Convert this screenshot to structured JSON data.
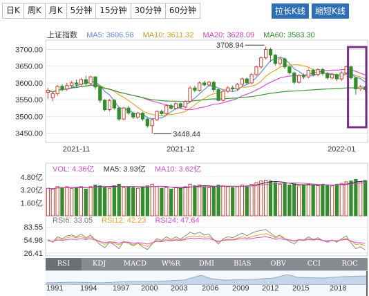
{
  "toolbar": {
    "tabs": [
      {
        "label": "日K",
        "active": true
      },
      {
        "label": "周K",
        "active": false
      },
      {
        "label": "月K",
        "active": false
      },
      {
        "label": "5分钟",
        "active": false
      },
      {
        "label": "15分钟",
        "active": false
      },
      {
        "label": "30分钟",
        "active": false
      },
      {
        "label": "60分钟",
        "active": false
      }
    ],
    "stretch_label": "拉长K线",
    "shrink_label": "缩短K线"
  },
  "main_legend": {
    "name": "上证指数",
    "ma5": "MA5: 3606.58",
    "ma10": "MA10: 3611.32",
    "ma20": "MA20: 3628.09",
    "ma60": "MA60: 3583.30"
  },
  "colors": {
    "up": "#d33b2c",
    "down": "#2f8f2a",
    "ma5": "#5b8fdc",
    "ma10": "#e0a72a",
    "ma20": "#d24bd0",
    "ma60": "#3b9a33",
    "highlight": "#7a2f8d",
    "tab_active": "#2b6cb3"
  },
  "price_axis": {
    "ticks": [
      "3700.00",
      "3650.00",
      "3600.00",
      "3550.00",
      "3500.00",
      "3450.00"
    ],
    "values": [
      3700,
      3650,
      3600,
      3550,
      3500,
      3450
    ],
    "min": 3422,
    "max": 3728
  },
  "date_axis": {
    "labels": [
      "2021-11",
      "2021-12",
      "2022-01"
    ]
  },
  "annotations": {
    "high": "3708.94",
    "low": "3448.44"
  },
  "candles": [
    [
      3572,
      3578,
      3552,
      3585
    ],
    [
      3556,
      3568,
      3545,
      3574
    ],
    [
      3568,
      3590,
      3562,
      3594
    ],
    [
      3590,
      3582,
      3575,
      3596
    ],
    [
      3582,
      3592,
      3576,
      3600
    ],
    [
      3592,
      3600,
      3586,
      3606
    ],
    [
      3600,
      3596,
      3588,
      3610
    ],
    [
      3596,
      3610,
      3590,
      3615
    ],
    [
      3610,
      3598,
      3592,
      3622
    ],
    [
      3598,
      3618,
      3594,
      3622
    ],
    [
      3618,
      3588,
      3580,
      3620
    ],
    [
      3588,
      3548,
      3540,
      3592
    ],
    [
      3548,
      3520,
      3515,
      3552
    ],
    [
      3520,
      3548,
      3515,
      3552
    ],
    [
      3548,
      3525,
      3520,
      3552
    ],
    [
      3525,
      3492,
      3486,
      3528
    ],
    [
      3492,
      3525,
      3488,
      3528
    ],
    [
      3525,
      3510,
      3505,
      3532
    ],
    [
      3510,
      3498,
      3492,
      3514
    ],
    [
      3498,
      3510,
      3492,
      3514
    ],
    [
      3510,
      3492,
      3486,
      3514
    ],
    [
      3492,
      3472,
      3466,
      3496
    ],
    [
      3472,
      3490,
      3448,
      3494
    ],
    [
      3490,
      3515,
      3486,
      3518
    ],
    [
      3515,
      3508,
      3503,
      3520
    ],
    [
      3508,
      3532,
      3504,
      3536
    ],
    [
      3532,
      3524,
      3520,
      3538
    ],
    [
      3524,
      3538,
      3520,
      3542
    ],
    [
      3538,
      3528,
      3522,
      3541
    ],
    [
      3528,
      3545,
      3524,
      3548
    ],
    [
      3545,
      3585,
      3540,
      3590
    ],
    [
      3585,
      3578,
      3572,
      3592
    ],
    [
      3578,
      3600,
      3574,
      3604
    ],
    [
      3600,
      3594,
      3590,
      3606
    ],
    [
      3594,
      3602,
      3590,
      3606
    ],
    [
      3602,
      3580,
      3572,
      3606
    ],
    [
      3580,
      3548,
      3545,
      3584
    ],
    [
      3548,
      3575,
      3544,
      3580
    ],
    [
      3575,
      3585,
      3570,
      3590
    ],
    [
      3585,
      3582,
      3576,
      3592
    ],
    [
      3582,
      3596,
      3578,
      3600
    ],
    [
      3596,
      3612,
      3590,
      3616
    ],
    [
      3612,
      3600,
      3595,
      3616
    ],
    [
      3600,
      3625,
      3596,
      3630
    ],
    [
      3625,
      3648,
      3620,
      3652
    ],
    [
      3648,
      3675,
      3643,
      3679
    ],
    [
      3675,
      3700,
      3670,
      3709
    ],
    [
      3700,
      3683,
      3662,
      3705
    ],
    [
      3683,
      3658,
      3652,
      3686
    ],
    [
      3658,
      3672,
      3652,
      3676
    ],
    [
      3672,
      3648,
      3642,
      3676
    ],
    [
      3648,
      3630,
      3625,
      3652
    ],
    [
      3630,
      3602,
      3596,
      3634
    ],
    [
      3602,
      3622,
      3598,
      3626
    ],
    [
      3622,
      3618,
      3612,
      3628
    ],
    [
      3618,
      3638,
      3614,
      3642
    ],
    [
      3638,
      3625,
      3620,
      3642
    ],
    [
      3625,
      3640,
      3620,
      3644
    ],
    [
      3640,
      3628,
      3622,
      3645
    ],
    [
      3628,
      3615,
      3610,
      3632
    ],
    [
      3615,
      3625,
      3610,
      3630
    ],
    [
      3625,
      3612,
      3606,
      3628
    ],
    [
      3612,
      3630,
      3606,
      3636
    ],
    [
      3630,
      3648,
      3626,
      3652
    ],
    [
      3648,
      3615,
      3610,
      3652
    ],
    [
      3615,
      3582,
      3565,
      3618
    ],
    [
      3582,
      3588,
      3576,
      3594
    ],
    [
      3588,
      3580,
      3574,
      3592
    ]
  ],
  "volume_legend": {
    "vol": "VOL: 4.36亿",
    "ma5": "MA5: 3.93亿",
    "ma10": "MA10: 3.62亿"
  },
  "volume_axis": {
    "ticks": [
      "4.80亿",
      "3.20亿",
      "1.60亿"
    ],
    "values": [
      4.8,
      3.2,
      1.6
    ],
    "max": 5.3
  },
  "volume": [
    3.4,
    3.3,
    3.6,
    3.5,
    3.6,
    3.4,
    3.5,
    3.6,
    3.3,
    3.6,
    3.8,
    3.7,
    3.6,
    3.4,
    3.7,
    3.9,
    3.5,
    3.6,
    3.5,
    3.4,
    3.6,
    3.7,
    3.9,
    3.6,
    3.4,
    3.5,
    3.3,
    3.5,
    3.4,
    3.6,
    3.9,
    3.7,
    3.8,
    3.6,
    3.5,
    3.6,
    3.8,
    3.7,
    3.6,
    3.5,
    3.6,
    3.8,
    3.7,
    3.9,
    4.1,
    4.3,
    4.4,
    4.3,
    4.1,
    3.9,
    4.0,
    3.8,
    3.9,
    3.7,
    3.8,
    3.9,
    3.8,
    3.7,
    3.9,
    3.8,
    3.7,
    3.9,
    4.0,
    4.2,
    4.3,
    4.5,
    4.2,
    4.36
  ],
  "rsi_legend": {
    "rsi6": "RSI6: 33.05",
    "rsi12": "RSI12: 42.23",
    "rsi24": "RSI24: 47.64"
  },
  "rsi_axis": {
    "ticks": [
      "83.55",
      "54.98",
      "26.41"
    ],
    "values": [
      83.55,
      54.98,
      26.41
    ]
  },
  "rsi6": [
    56,
    50,
    62,
    58,
    64,
    66,
    62,
    68,
    60,
    66,
    55,
    45,
    38,
    50,
    44,
    36,
    52,
    48,
    42,
    48,
    40,
    34,
    46,
    58,
    54,
    62,
    56,
    62,
    57,
    64,
    72,
    68,
    72,
    66,
    68,
    56,
    46,
    58,
    62,
    60,
    65,
    70,
    64,
    70,
    74,
    76,
    78,
    70,
    62,
    66,
    58,
    52,
    46,
    56,
    55,
    62,
    56,
    60,
    54,
    50,
    55,
    50,
    58,
    64,
    48,
    36,
    40,
    33
  ],
  "rsi12": [
    54,
    51,
    58,
    56,
    60,
    62,
    60,
    63,
    58,
    62,
    56,
    50,
    45,
    50,
    48,
    44,
    50,
    48,
    45,
    48,
    44,
    41,
    47,
    54,
    52,
    57,
    54,
    57,
    55,
    59,
    64,
    62,
    64,
    61,
    62,
    56,
    50,
    55,
    57,
    56,
    59,
    62,
    59,
    62,
    65,
    67,
    69,
    65,
    60,
    62,
    58,
    55,
    52,
    56,
    55,
    58,
    55,
    57,
    54,
    52,
    54,
    52,
    56,
    59,
    52,
    45,
    46,
    42
  ],
  "rsi24": [
    53,
    52,
    55,
    54,
    56,
    57,
    56,
    58,
    56,
    58,
    55,
    52,
    49,
    51,
    50,
    48,
    51,
    50,
    48,
    49,
    48,
    46,
    49,
    52,
    51,
    54,
    53,
    55,
    54,
    56,
    59,
    58,
    59,
    57,
    58,
    55,
    52,
    54,
    55,
    55,
    57,
    58,
    57,
    58,
    60,
    61,
    62,
    60,
    57,
    58,
    56,
    55,
    53,
    55,
    54,
    56,
    55,
    56,
    54,
    53,
    54,
    53,
    55,
    56,
    53,
    49,
    49,
    47.64
  ],
  "indicator_tabs": [
    {
      "label": "RSI",
      "active": true
    },
    {
      "label": "KDJ",
      "active": false
    },
    {
      "label": "MACD",
      "active": false
    },
    {
      "label": "W%R",
      "active": false
    },
    {
      "label": "DMI",
      "active": false
    },
    {
      "label": "BIAS",
      "active": false
    },
    {
      "label": "OBV",
      "active": false
    },
    {
      "label": "CCI",
      "active": false
    },
    {
      "label": "ROC",
      "active": false
    }
  ],
  "range_years": [
    "1991",
    "1994",
    "1997",
    "2000",
    "2003",
    "2006",
    "2009",
    "2012",
    "2015",
    "2018"
  ]
}
